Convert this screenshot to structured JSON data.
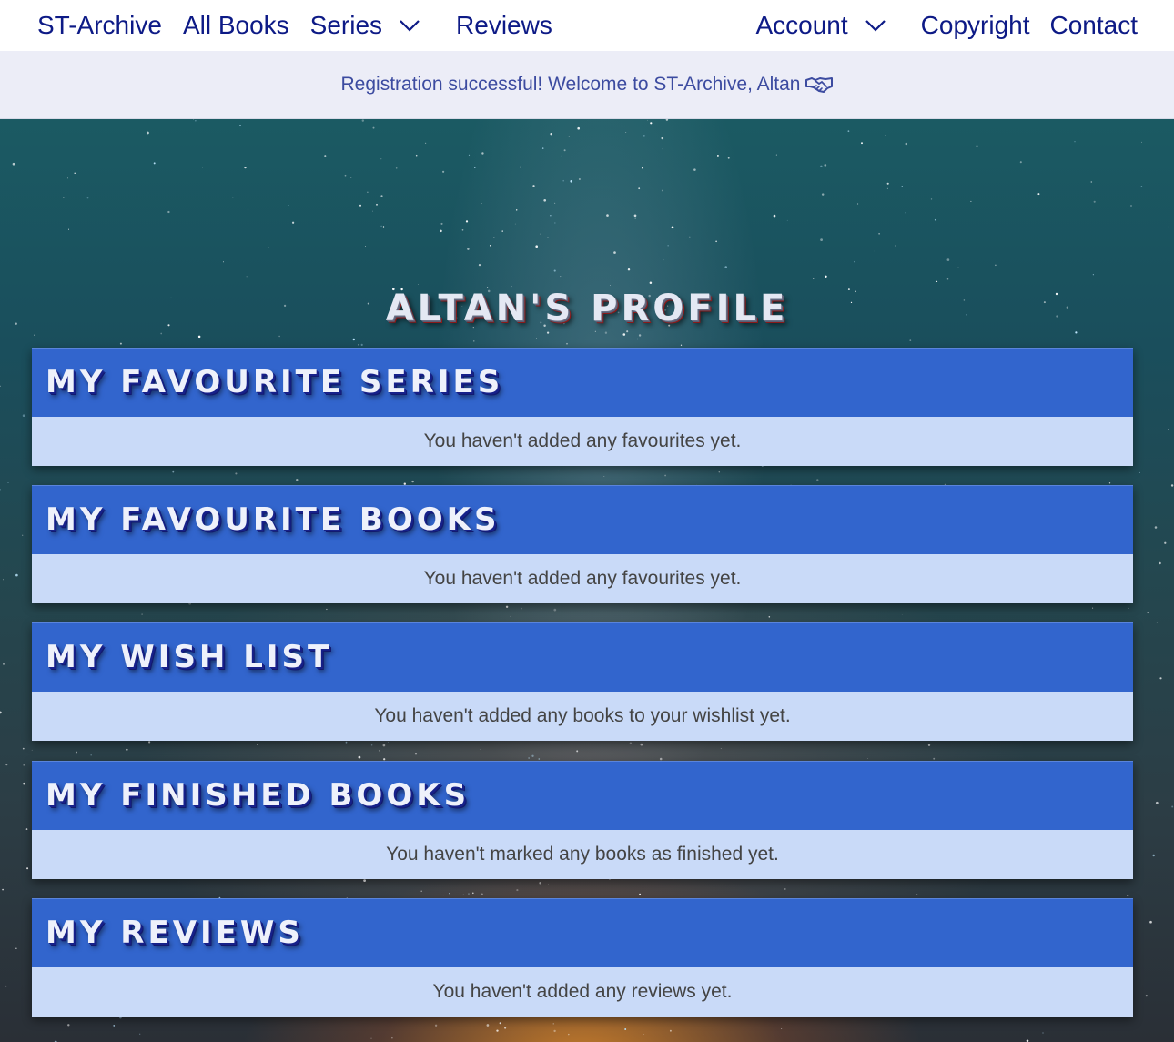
{
  "nav": {
    "brand": "ST-Archive",
    "all_books": "All Books",
    "series": "Series",
    "reviews": "Reviews",
    "account": "Account",
    "copyright": "Copyright",
    "contact": "Contact"
  },
  "alert": {
    "message": "Registration successful! Welcome to ST-Archive, Altan",
    "icon": "handshake-icon"
  },
  "profile": {
    "title": "Altan's Profile",
    "sections": [
      {
        "title": "My Favourite Series",
        "message": "You haven't added any favourites yet."
      },
      {
        "title": "My Favourite Books",
        "message": "You haven't added any favourites yet."
      },
      {
        "title": "My Wish List",
        "message": "You haven't added any books to your wishlist yet."
      },
      {
        "title": "My Finished Books",
        "message": "You haven't marked any books as finished yet."
      },
      {
        "title": "My Reviews",
        "message": "You haven't added any reviews yet."
      }
    ]
  },
  "colors": {
    "nav_text": "#0d1a86",
    "alert_bg": "#ecedf7",
    "alert_text": "#3c4ba0",
    "card_header": "#3265cd",
    "card_body": "#c9daf8"
  }
}
